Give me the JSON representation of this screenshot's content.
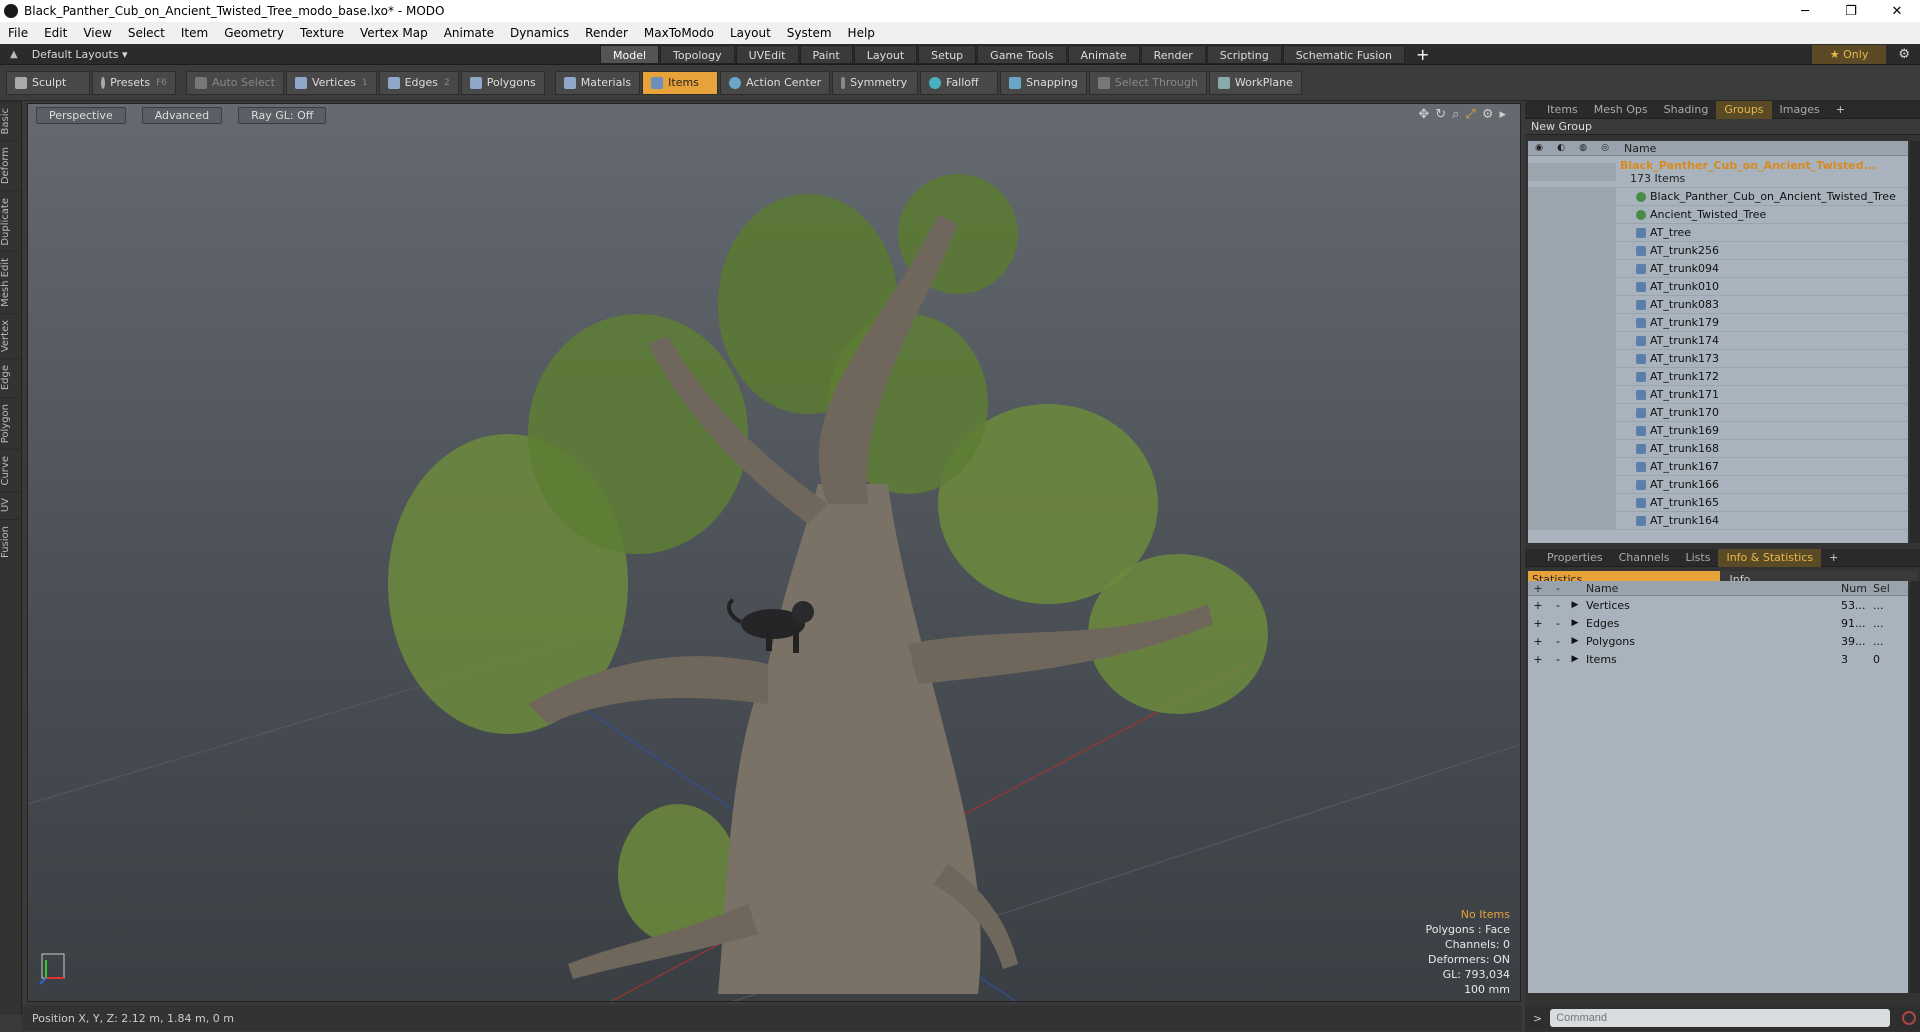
{
  "window": {
    "title": "Black_Panther_Cub_on_Ancient_Twisted_Tree_modo_base.lxo* - MODO"
  },
  "menu": [
    "File",
    "Edit",
    "View",
    "Select",
    "Item",
    "Geometry",
    "Texture",
    "Vertex Map",
    "Animate",
    "Dynamics",
    "Render",
    "MaxToModo",
    "Layout",
    "System",
    "Help"
  ],
  "layoutbar": {
    "layouts": "Default Layouts ▾",
    "tabs": [
      "Model",
      "Topology",
      "UVEdit",
      "Paint",
      "Layout",
      "Setup",
      "Game Tools",
      "Animate",
      "Render",
      "Scripting",
      "Schematic Fusion"
    ],
    "active_tab": "Model",
    "only": "★  Only"
  },
  "toolbar": {
    "sculpt": "Sculpt",
    "presets": "Presets",
    "presets_key": "F6",
    "auto_select": "Auto Select",
    "vertices": "Vertices",
    "vertices_key": "1",
    "edges": "Edges",
    "edges_key": "2",
    "polygons": "Polygons",
    "materials": "Materials",
    "items": "Items",
    "action_center": "Action Center",
    "symmetry": "Symmetry",
    "falloff": "Falloff",
    "snapping": "Snapping",
    "select_through": "Select Through",
    "workplane": "WorkPlane"
  },
  "lefttabs": [
    "Basic",
    "Deform",
    "Duplicate",
    "Mesh Edit",
    "Vertex",
    "Edge",
    "Polygon",
    "Curve",
    "UV",
    "Fusion"
  ],
  "viewport": {
    "perspective": "Perspective",
    "advanced": "Advanced",
    "raygl": "Ray GL: Off",
    "stats": {
      "items": "No Items",
      "polygons": "Polygons : Face",
      "channels": "Channels: 0",
      "deformers": "Deformers: ON",
      "gl": "GL: 793,034",
      "scale": "100 mm"
    }
  },
  "status": {
    "position": "Position X, Y, Z:   2.12 m, 1.84 m, 0 m"
  },
  "itempanel": {
    "tabs": [
      "Items",
      "Mesh Ops",
      "Shading",
      "Groups",
      "Images"
    ],
    "active_tab": "Groups",
    "new_group": "New Group",
    "name_header": "Name",
    "root": {
      "name": "Black_Panther_Cub_on_Ancient_Twisted...",
      "count": "173 Items"
    },
    "rows": [
      "Black_Panther_Cub_on_Ancient_Twisted_Tree",
      "Ancient_Twisted_Tree",
      "AT_tree",
      "AT_trunk256",
      "AT_trunk094",
      "AT_trunk010",
      "AT_trunk083",
      "AT_trunk179",
      "AT_trunk174",
      "AT_trunk173",
      "AT_trunk172",
      "AT_trunk171",
      "AT_trunk170",
      "AT_trunk169",
      "AT_trunk168",
      "AT_trunk167",
      "AT_trunk166",
      "AT_trunk165",
      "AT_trunk164"
    ]
  },
  "infopanel": {
    "tabs": [
      "Properties",
      "Channels",
      "Lists",
      "Info & Statistics"
    ],
    "active_tab": "Info & Statistics",
    "statistics": "Statistics",
    "info": "Info",
    "headers": {
      "plus": "+",
      "minus": "-",
      "name": "Name",
      "num": "Num",
      "sel": "Sel"
    },
    "rows": [
      {
        "name": "Vertices",
        "num": "53...",
        "sel": "..."
      },
      {
        "name": "Edges",
        "num": "91...",
        "sel": "..."
      },
      {
        "name": "Polygons",
        "num": "39...",
        "sel": "..."
      },
      {
        "name": "Items",
        "num": "3",
        "sel": "0"
      }
    ],
    "command_placeholder": "Command"
  }
}
